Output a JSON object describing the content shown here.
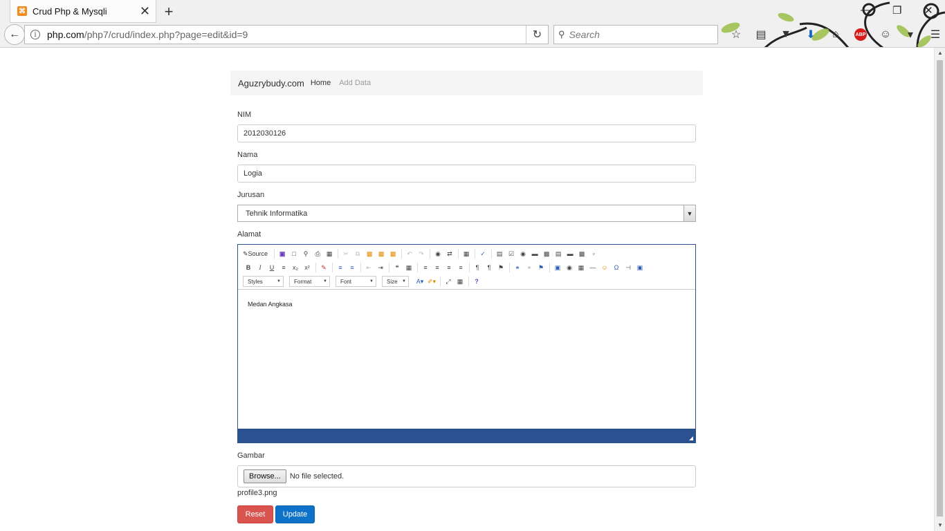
{
  "browser": {
    "tab_title": "Crud Php & Mysqli",
    "url_host": "php.com",
    "url_path": "/php7/crud/index.php?page=edit&id=9",
    "search_placeholder": "Search",
    "abp_badge": "ABP"
  },
  "site_nav": {
    "brand": "Aguzrybudy.com",
    "home": "Home",
    "add_data": "Add Data"
  },
  "form": {
    "nim_label": "NIM",
    "nim_value": "2012030126",
    "nama_label": "Nama",
    "nama_value": "Logia",
    "jurusan_label": "Jurusan",
    "jurusan_value": "Tehnik Informatika",
    "alamat_label": "Alamat",
    "alamat_value": "Medan Angkasa",
    "gambar_label": "Gambar",
    "browse_label": "Browse...",
    "file_status": "No file selected.",
    "current_file": "profile3.png",
    "reset_label": "Reset",
    "update_label": "Update"
  },
  "editor": {
    "source_label": "Source",
    "styles_label": "Styles",
    "format_label": "Format",
    "font_label": "Font",
    "size_label": "Size"
  },
  "colors": {
    "editor_border": "#2b5191",
    "reset_button": "#d9534f",
    "update_button": "#0f72c9"
  }
}
